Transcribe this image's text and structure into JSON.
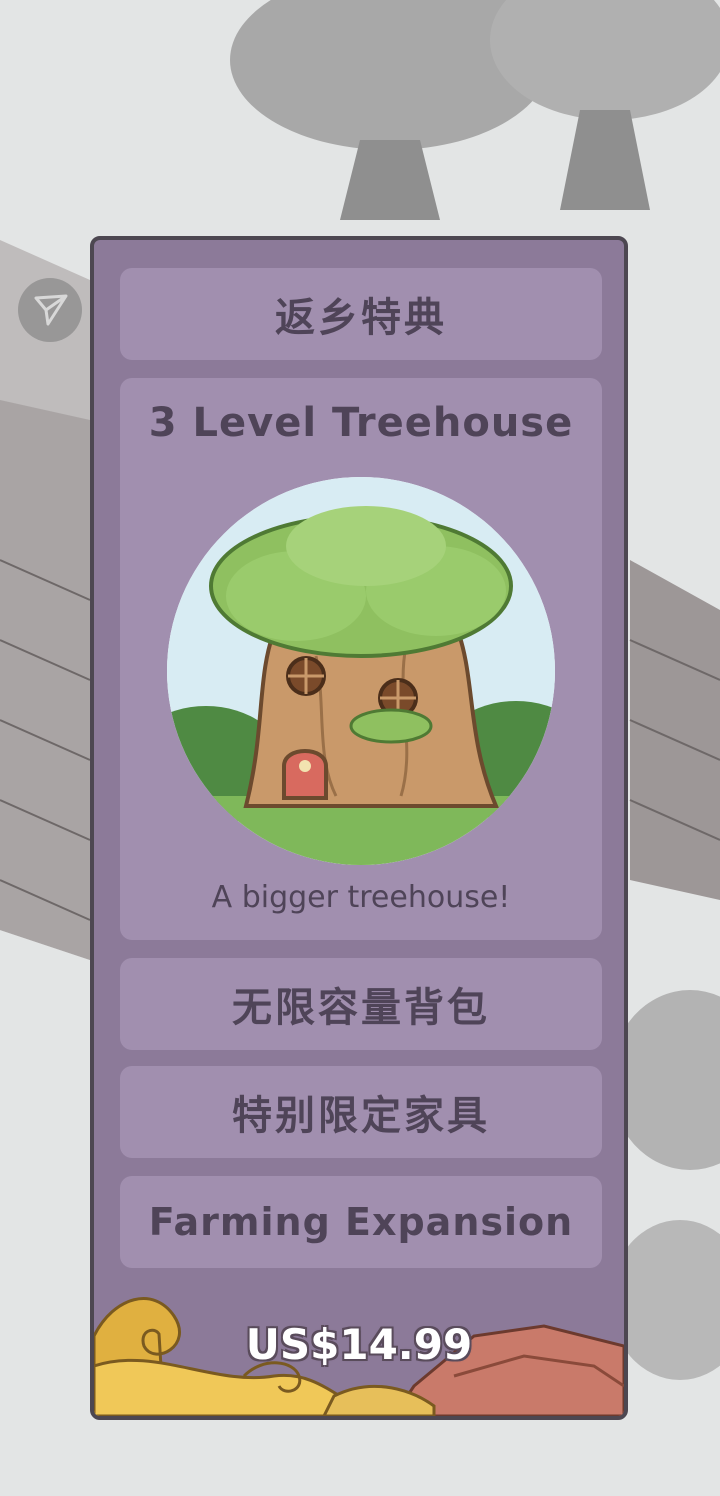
{
  "offer": {
    "title": "返乡特典",
    "feature": {
      "name": "3 Level Treehouse",
      "description": "A bigger treehouse!",
      "image_icon": "treehouse-illustration"
    },
    "benefits": [
      "无限容量背包",
      "特别限定家具",
      "Farming Expansion"
    ],
    "price": "US$14.99"
  },
  "nav": {
    "icon": "send-arrow-icon"
  },
  "colors": {
    "panel_bg": "#8c7a99",
    "card_bg": "#a18faf",
    "panel_border": "#4d4751",
    "text": "#4f4458",
    "price_text": "#ffffff"
  }
}
